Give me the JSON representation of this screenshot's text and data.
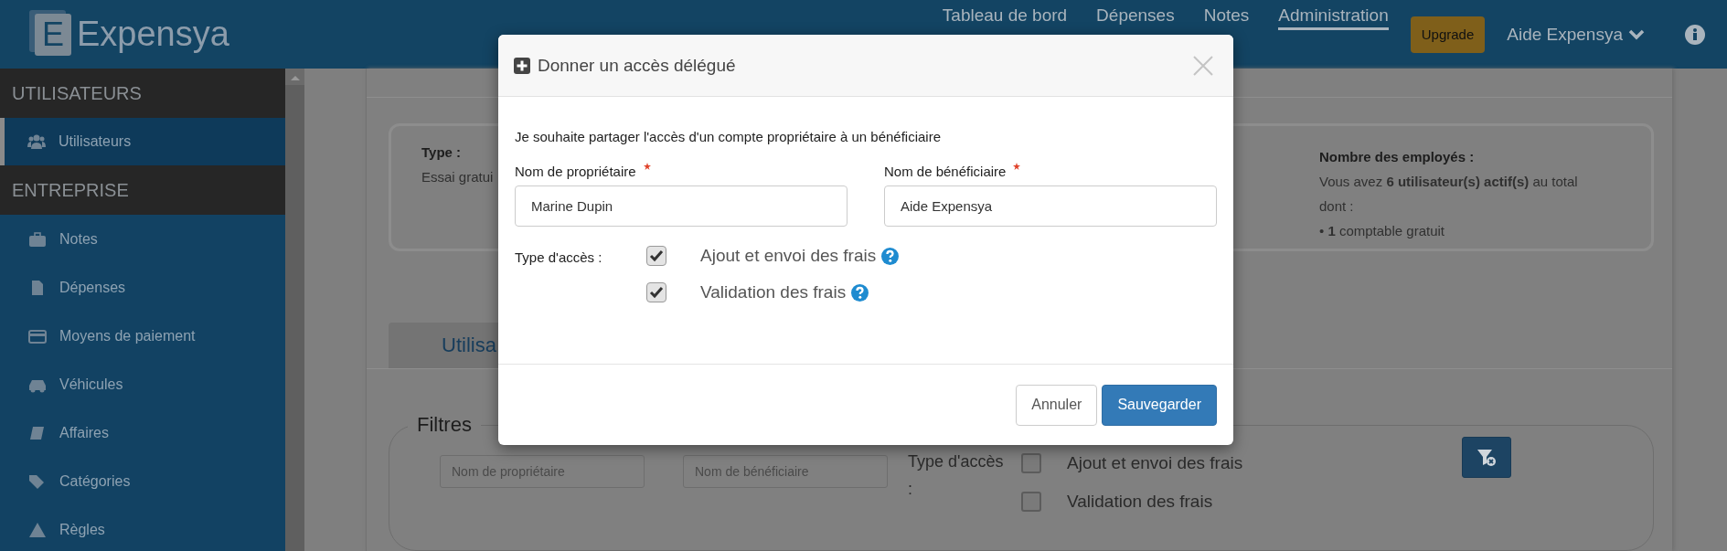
{
  "header": {
    "logo_mark": "E",
    "logo": "Expensya",
    "nav": [
      {
        "label": "Tableau de bord",
        "selected": false
      },
      {
        "label": "Dépenses",
        "selected": false
      },
      {
        "label": "Notes",
        "selected": false
      },
      {
        "label": "Administration",
        "selected": true
      }
    ],
    "upgrade": "Upgrade",
    "user": "Aide Expensya"
  },
  "sidebar": [
    {
      "title": "UTILISATEURS",
      "items": [
        {
          "label": "Utilisateurs",
          "selected": true
        }
      ]
    },
    {
      "title": "ENTREPRISE",
      "items": [
        {
          "label": "Notes",
          "selected": false
        },
        {
          "label": "Dépenses",
          "selected": false
        },
        {
          "label": "Moyens de paiement",
          "selected": false
        },
        {
          "label": "Véhicules",
          "selected": false
        },
        {
          "label": "Affaires",
          "selected": false
        },
        {
          "label": "Catégories",
          "selected": false
        },
        {
          "label": "Règles",
          "selected": false
        }
      ]
    }
  ],
  "summary": {
    "type_label": "Type :",
    "type_value": "Essai gratui",
    "employees_label": "Nombre des employés :",
    "employees_text": "Vous avez **6 utilisateur(s) actif(s)** au total dont :",
    "accountant": "• **1** comptable gratuit"
  },
  "tab": "Utilisa",
  "filters": {
    "legend": "Filtres",
    "owner_placeholder": "Nom de propriétaire",
    "beneficiary_placeholder": "Nom de bénéficiaire",
    "access_label": "Type d'accès :",
    "options": [
      {
        "label": "Ajout et envoi des frais",
        "checked": false
      },
      {
        "label": "Validation des frais",
        "checked": false
      }
    ]
  },
  "modal": {
    "title": "Donner un accès délégué",
    "intro": "Je souhaite partager l'accès d'un compte propriétaire à un bénéficiaire",
    "fields": [
      {
        "label": "Nom de propriétaire",
        "required": true,
        "value": "Marine Dupin"
      },
      {
        "label": "Nom de bénéficiaire",
        "required": true,
        "value": "Aide Expensya"
      }
    ],
    "access_label": "Type d'accès :",
    "options": [
      {
        "label": "Ajout et envoi des frais",
        "checked": true
      },
      {
        "label": "Validation des frais",
        "checked": true
      }
    ],
    "buttons": [
      {
        "label": "Annuler",
        "kind": "default"
      },
      {
        "label": "Sauvegarder",
        "kind": "primary"
      }
    ]
  }
}
